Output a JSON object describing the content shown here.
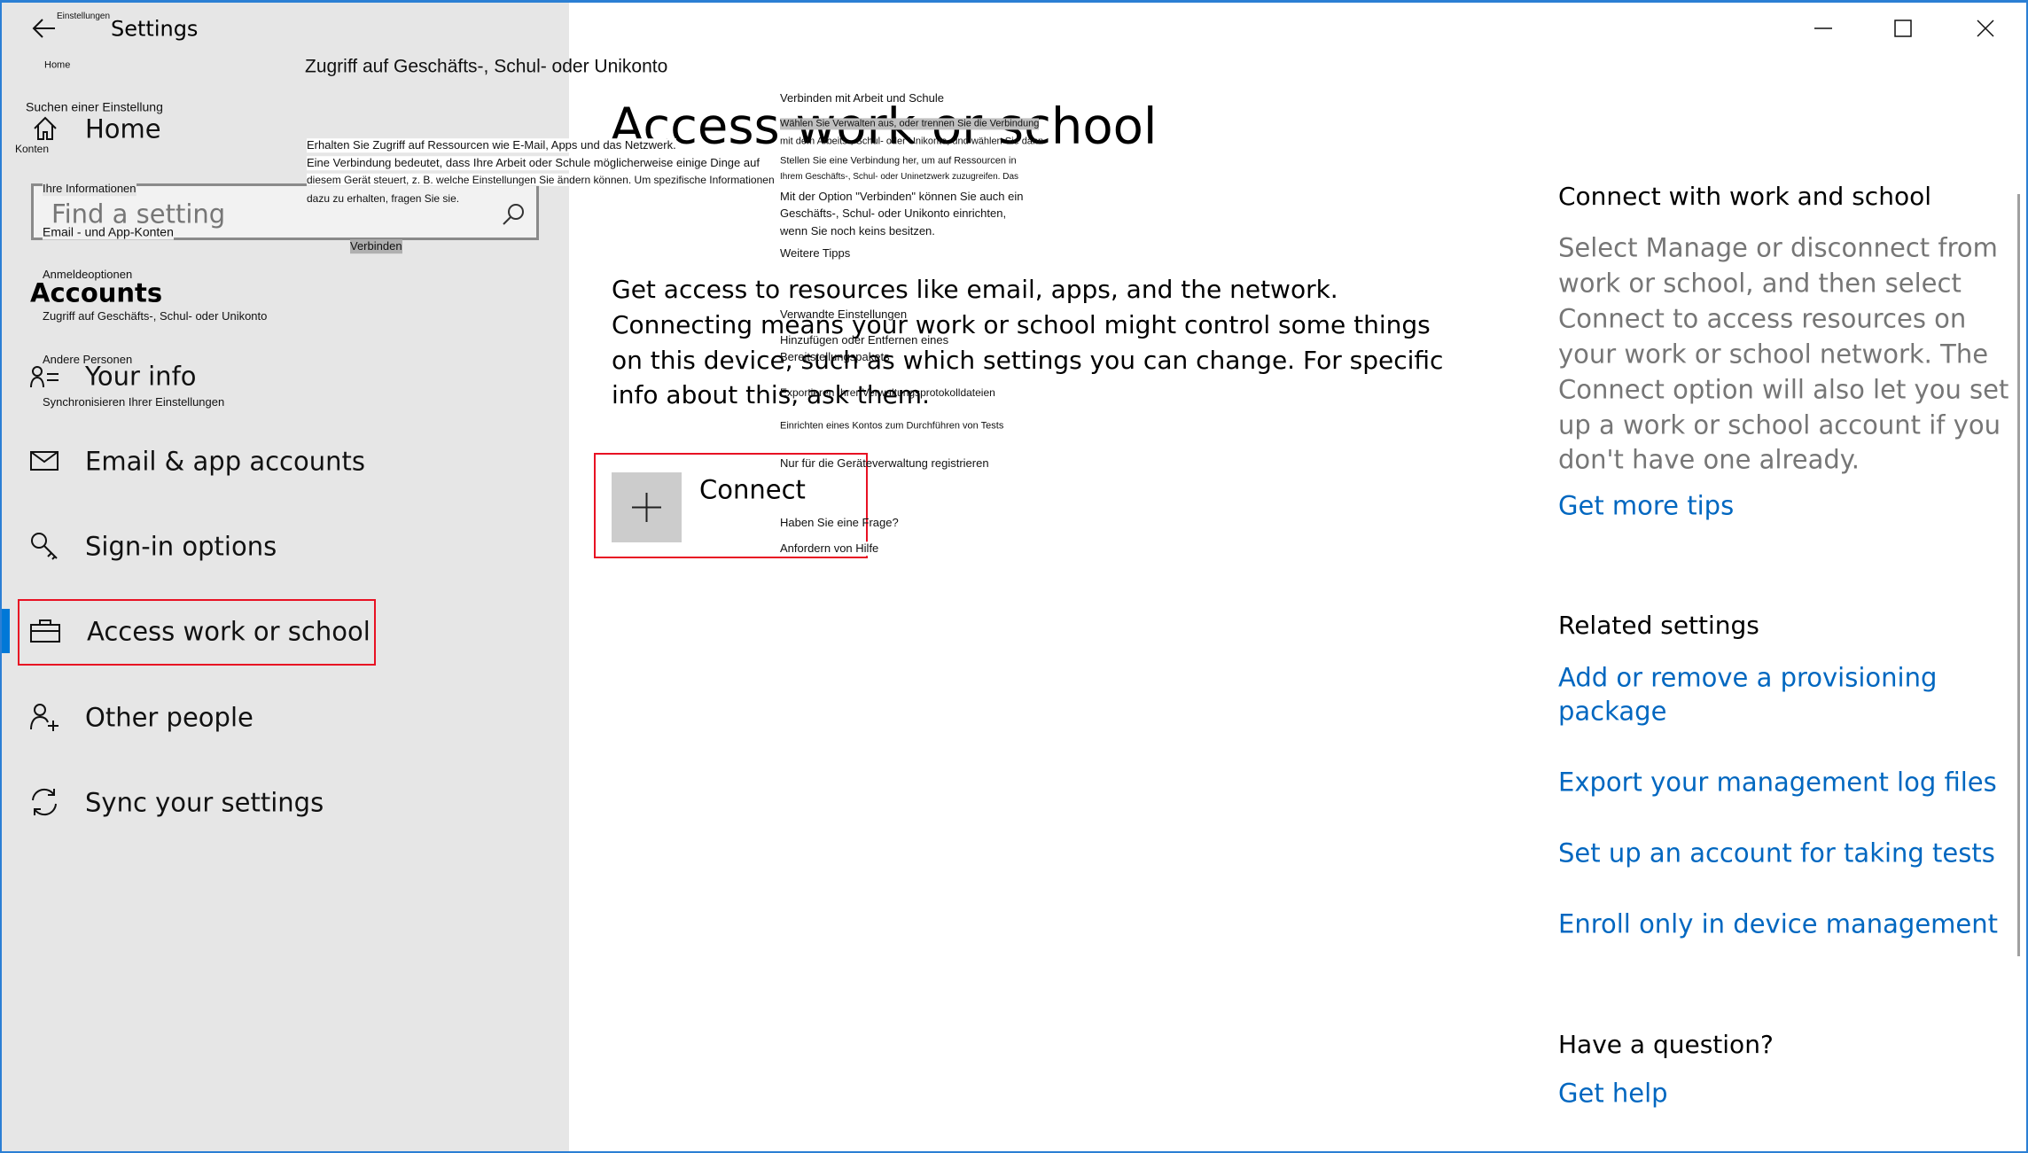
{
  "window": {
    "title": "Settings",
    "title_de": "Einstellungen",
    "controls": {
      "minimize": "minimize-icon",
      "maximize": "maximize-icon",
      "close": "close-icon"
    }
  },
  "sidebar": {
    "home_de": "Home",
    "search_label_de": "Suchen einer Einstellung",
    "home": "Home",
    "konten_de": "Konten",
    "search_placeholder": "Find a setting",
    "search_overlay_top_de": "Ihre Informationen",
    "search_overlay_bottom_de": "Email - und App-Konten",
    "verbinden_de": "Verbinden",
    "section_title": "Accounts",
    "section_above_de": "Anmeldeoptionen",
    "section_below_de": "Zugriff auf Geschäfts-, Schul- oder Unikonto",
    "andere_de": "Andere Personen",
    "sync_de": "Synchronisieren Ihrer Einstellungen",
    "items": [
      {
        "label": "Your info",
        "icon": "person-list-icon"
      },
      {
        "label": "Email & app accounts",
        "icon": "mail-icon"
      },
      {
        "label": "Sign-in options",
        "icon": "key-icon"
      },
      {
        "label": "Access work or school",
        "icon": "briefcase-icon",
        "selected": true
      },
      {
        "label": "Other people",
        "icon": "person-add-icon"
      },
      {
        "label": "Sync your settings",
        "icon": "sync-icon"
      }
    ],
    "accent": "#0078d7"
  },
  "main": {
    "title_de": "Zugriff auf Geschäfts-, Schul- oder Unikonto",
    "title": "Access work or school",
    "intro_de": [
      "Erhalten Sie Zugriff auf Ressourcen wie E-Mail, Apps und das Netzwerk.",
      "Eine Verbindung bedeutet, dass Ihre Arbeit oder Schule möglicherweise einige Dinge auf",
      "diesem Gerät steuert, z. B. welche Einstellungen Sie ändern können. Um spezifische Informationen",
      "dazu zu erhalten, fragen Sie sie."
    ],
    "intro": [
      "Get access to resources like email, apps, and the network.",
      "Connecting means your work or school might control some things",
      "on this device, such as which settings you can change. For specific",
      "info about this, ask them."
    ],
    "connect_label": "Connect",
    "side_de": [
      "Verbinden mit Arbeit und Schule",
      "Wählen Sie Verwalten aus, oder trennen Sie die Verbindung",
      "mit dem Arbeits-, Schul- oder Unikonto, und wählen Sie dann",
      "Stellen Sie eine Verbindung her, um auf Ressourcen in",
      "Ihrem Geschäfts-, Schul- oder Uninetzwerk zuzugreifen. Das",
      "Mit der Option \"Verbinden\" können Sie auch ein",
      "Geschäfts-, Schul- oder Unikonto einrichten,",
      "wenn Sie noch keins besitzen.",
      "Weitere Tipps",
      "Verwandte Einstellungen",
      "Hinzufügen oder Entfernen eines",
      "Bereitstellungspakets",
      "Exportieren Ihrer Verwaltungsprotokolldateien",
      "Einrichten eines Kontos zum Durchführen von Tests",
      "Nur für die Geräteverwaltung registrieren",
      "Haben Sie eine Frage?",
      "Anfordern von Hilfe"
    ]
  },
  "right": {
    "heading": "Connect with work and school",
    "body": [
      "Select Manage or disconnect from",
      "work or school, and then select",
      "Connect to access resources on",
      "your work or school network. The",
      "Connect option will also let you set",
      "up a work or school account if you",
      "don't have one already."
    ],
    "more_tips": "Get more tips",
    "related_heading": "Related settings",
    "related": [
      [
        "Add or remove a provisioning",
        "package"
      ],
      [
        "Export your management log files"
      ],
      [
        "Set up an account for taking tests"
      ],
      [
        "Enroll only in device management"
      ]
    ],
    "question_heading": "Have a question?",
    "get_help": "Get help",
    "link_color": "#0067c0"
  }
}
